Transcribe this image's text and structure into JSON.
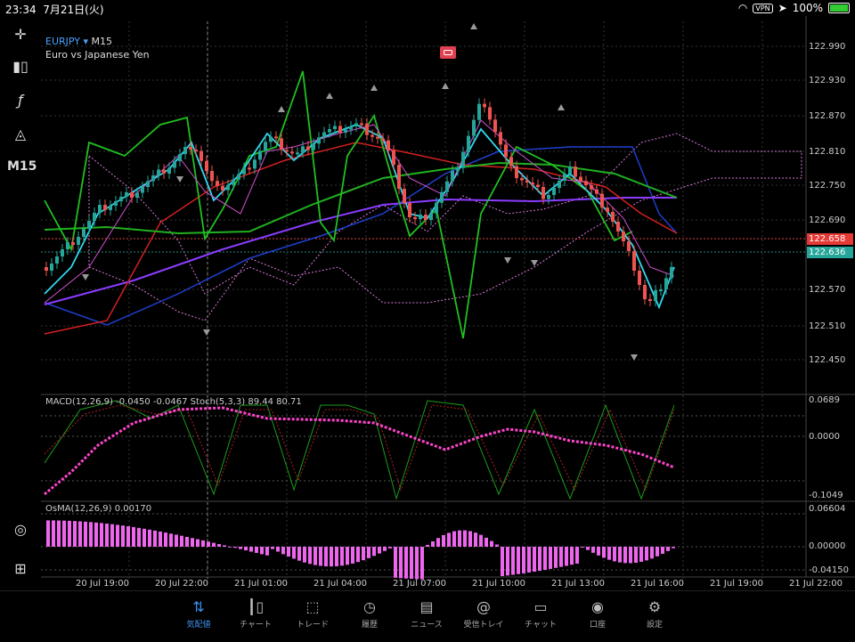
{
  "status_bar": {
    "time": "23:34",
    "date": "7月21日(火)",
    "vpn": "VPN",
    "battery": "100%"
  },
  "sidebar": {
    "timeframe": "M15"
  },
  "chart": {
    "symbol": "EURJPY",
    "timeframe": "M15",
    "description": "Euro vs Japanese Yen",
    "price_axis": [
      "122.990",
      "122.930",
      "122.870",
      "122.810",
      "122.750",
      "122.690",
      "122.570",
      "122.510",
      "122.450"
    ],
    "bid_price": "122.636",
    "ask_price": "122.658",
    "macd_label": "MACD(12,26,9) -0.0450 -0.0467 Stoch(5,3,3) 89.44 80.71",
    "macd_axis": [
      "0.0689",
      "0.0000",
      "-0.1049"
    ],
    "osma_label": "OsMA(12,26,9) 0.00170",
    "osma_axis": [
      "0.06604",
      "0.00000",
      "-0.04150"
    ],
    "time_axis": [
      "20 Jul 19:00",
      "20 Jul 22:00",
      "21 Jul 01:00",
      "21 Jul 04:00",
      "21 Jul 07:00",
      "21 Jul 10:00",
      "21 Jul 13:00",
      "21 Jul 16:00",
      "21 Jul 19:00",
      "21 Jul 22:00"
    ],
    "colors": {
      "bull": "#26a69a",
      "bear": "#ef5350",
      "macd_signal": "#ff44cc",
      "osma": "#ee66ee"
    }
  },
  "bottom_nav": [
    {
      "label": "気配値",
      "icon": "quotes-icon",
      "active": true
    },
    {
      "label": "チャート",
      "icon": "chart-icon",
      "active": false
    },
    {
      "label": "トレード",
      "icon": "trade-icon",
      "active": false
    },
    {
      "label": "履歴",
      "icon": "history-icon",
      "active": false
    },
    {
      "label": "ニュース",
      "icon": "news-icon",
      "active": false
    },
    {
      "label": "受信トレイ",
      "icon": "inbox-icon",
      "active": false
    },
    {
      "label": "チャット",
      "icon": "chat-icon",
      "active": false
    },
    {
      "label": "口座",
      "icon": "account-icon",
      "active": false
    },
    {
      "label": "設定",
      "icon": "settings-icon",
      "active": false
    }
  ]
}
